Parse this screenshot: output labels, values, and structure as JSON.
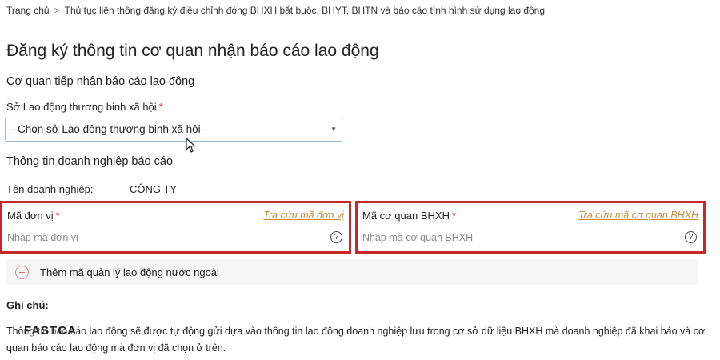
{
  "breadcrumb": {
    "home": "Trang chủ",
    "separator": ">",
    "current": "Thủ tục liên thông đăng ký điều chỉnh đóng BHXH bắt buộc, BHYT, BHTN và báo cáo tình hình sử dụng lao động"
  },
  "page": {
    "title": "Đăng ký thông tin cơ quan nhận báo cáo lao động"
  },
  "agency_section": {
    "title": "Cơ quan tiếp nhận báo cáo lao động",
    "dept_label": "Sở Lao động thương binh xã hội",
    "required_mark": "*",
    "dept_select_value": "--Chọn sở Lao động thương binh xã hội--"
  },
  "company_section": {
    "title": "Thông tin doanh nghiệp báo cáo",
    "name_label": "Tên doanh nghiệp:",
    "name_value": "CÔNG TY"
  },
  "unit_code": {
    "label": "Mã đơn vị",
    "required_mark": "*",
    "lookup_link": "Tra cứu mã đơn vị",
    "placeholder": "Nhập mã đơn vị"
  },
  "agency_code": {
    "label": "Mã cơ quan BHXH",
    "required_mark": "*",
    "lookup_link": "Tra cứu mã cơ quan BHXH",
    "placeholder": "Nhập mã cơ quan BHXH"
  },
  "add_foreign": {
    "label": "Thêm mã quản lý lao động nước ngoài"
  },
  "notes": {
    "title": "Ghi chú:",
    "text": "Thông tin báo cáo lao động sẽ được tự động gửi dựa vào thông tin lao động doanh nghiệp lưu trong cơ sở dữ liệu BHXH mà doanh nghiệp đã khai báo và cơ quan báo cáo lao động mà đơn vị đã chọn ở trên."
  },
  "watermark": {
    "logo_text": "FASTCA"
  },
  "colors": {
    "highlight_border": "#c62828",
    "link": "#c98a3d",
    "required": "#d93025"
  }
}
